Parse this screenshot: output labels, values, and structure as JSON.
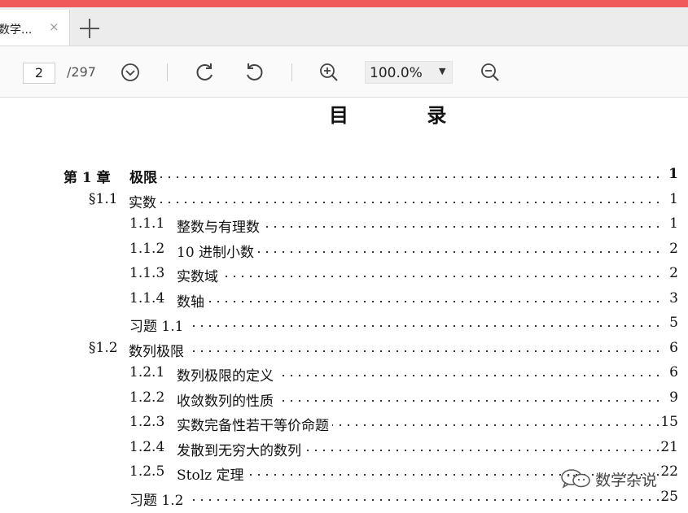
{
  "browser": {
    "tab_title": "数学...",
    "tab_close": "×"
  },
  "toolbar": {
    "current_page": "2",
    "page_total": "/297",
    "zoom": "100.0%",
    "zoom_caret": "▼"
  },
  "document": {
    "title": "目 录",
    "toc": [
      {
        "num": "第 1 章",
        "title": "极限",
        "page": "1",
        "bold": true
      },
      {
        "num": "§1.1",
        "title": "实数",
        "page": "1"
      },
      {
        "num": "1.1.1",
        "title": "整数与有理数",
        "page": "1"
      },
      {
        "num": "1.1.2",
        "title": "10 进制小数",
        "page": "2"
      },
      {
        "num": "1.1.3",
        "title": "实数域",
        "page": "2"
      },
      {
        "num": "1.1.4",
        "title": "数轴",
        "page": "3"
      },
      {
        "num": "",
        "title": "习题 1.1",
        "page": "5"
      },
      {
        "num": "§1.2",
        "title": "数列极限",
        "page": "6"
      },
      {
        "num": "1.2.1",
        "title": "数列极限的定义",
        "page": "6"
      },
      {
        "num": "1.2.2",
        "title": "收敛数列的性质",
        "page": "9"
      },
      {
        "num": "1.2.3",
        "title": "实数完备性若干等价命题",
        "page": "15"
      },
      {
        "num": "1.2.4",
        "title": "发散到无穷大的数列",
        "page": "21"
      },
      {
        "num": "1.2.5",
        "title": "Stolz 定理",
        "page": "22"
      },
      {
        "num": "",
        "title": "习题 1.2",
        "page": "25"
      }
    ]
  },
  "watermark": {
    "text": "数学杂说",
    "icon": "wechat-icon"
  }
}
